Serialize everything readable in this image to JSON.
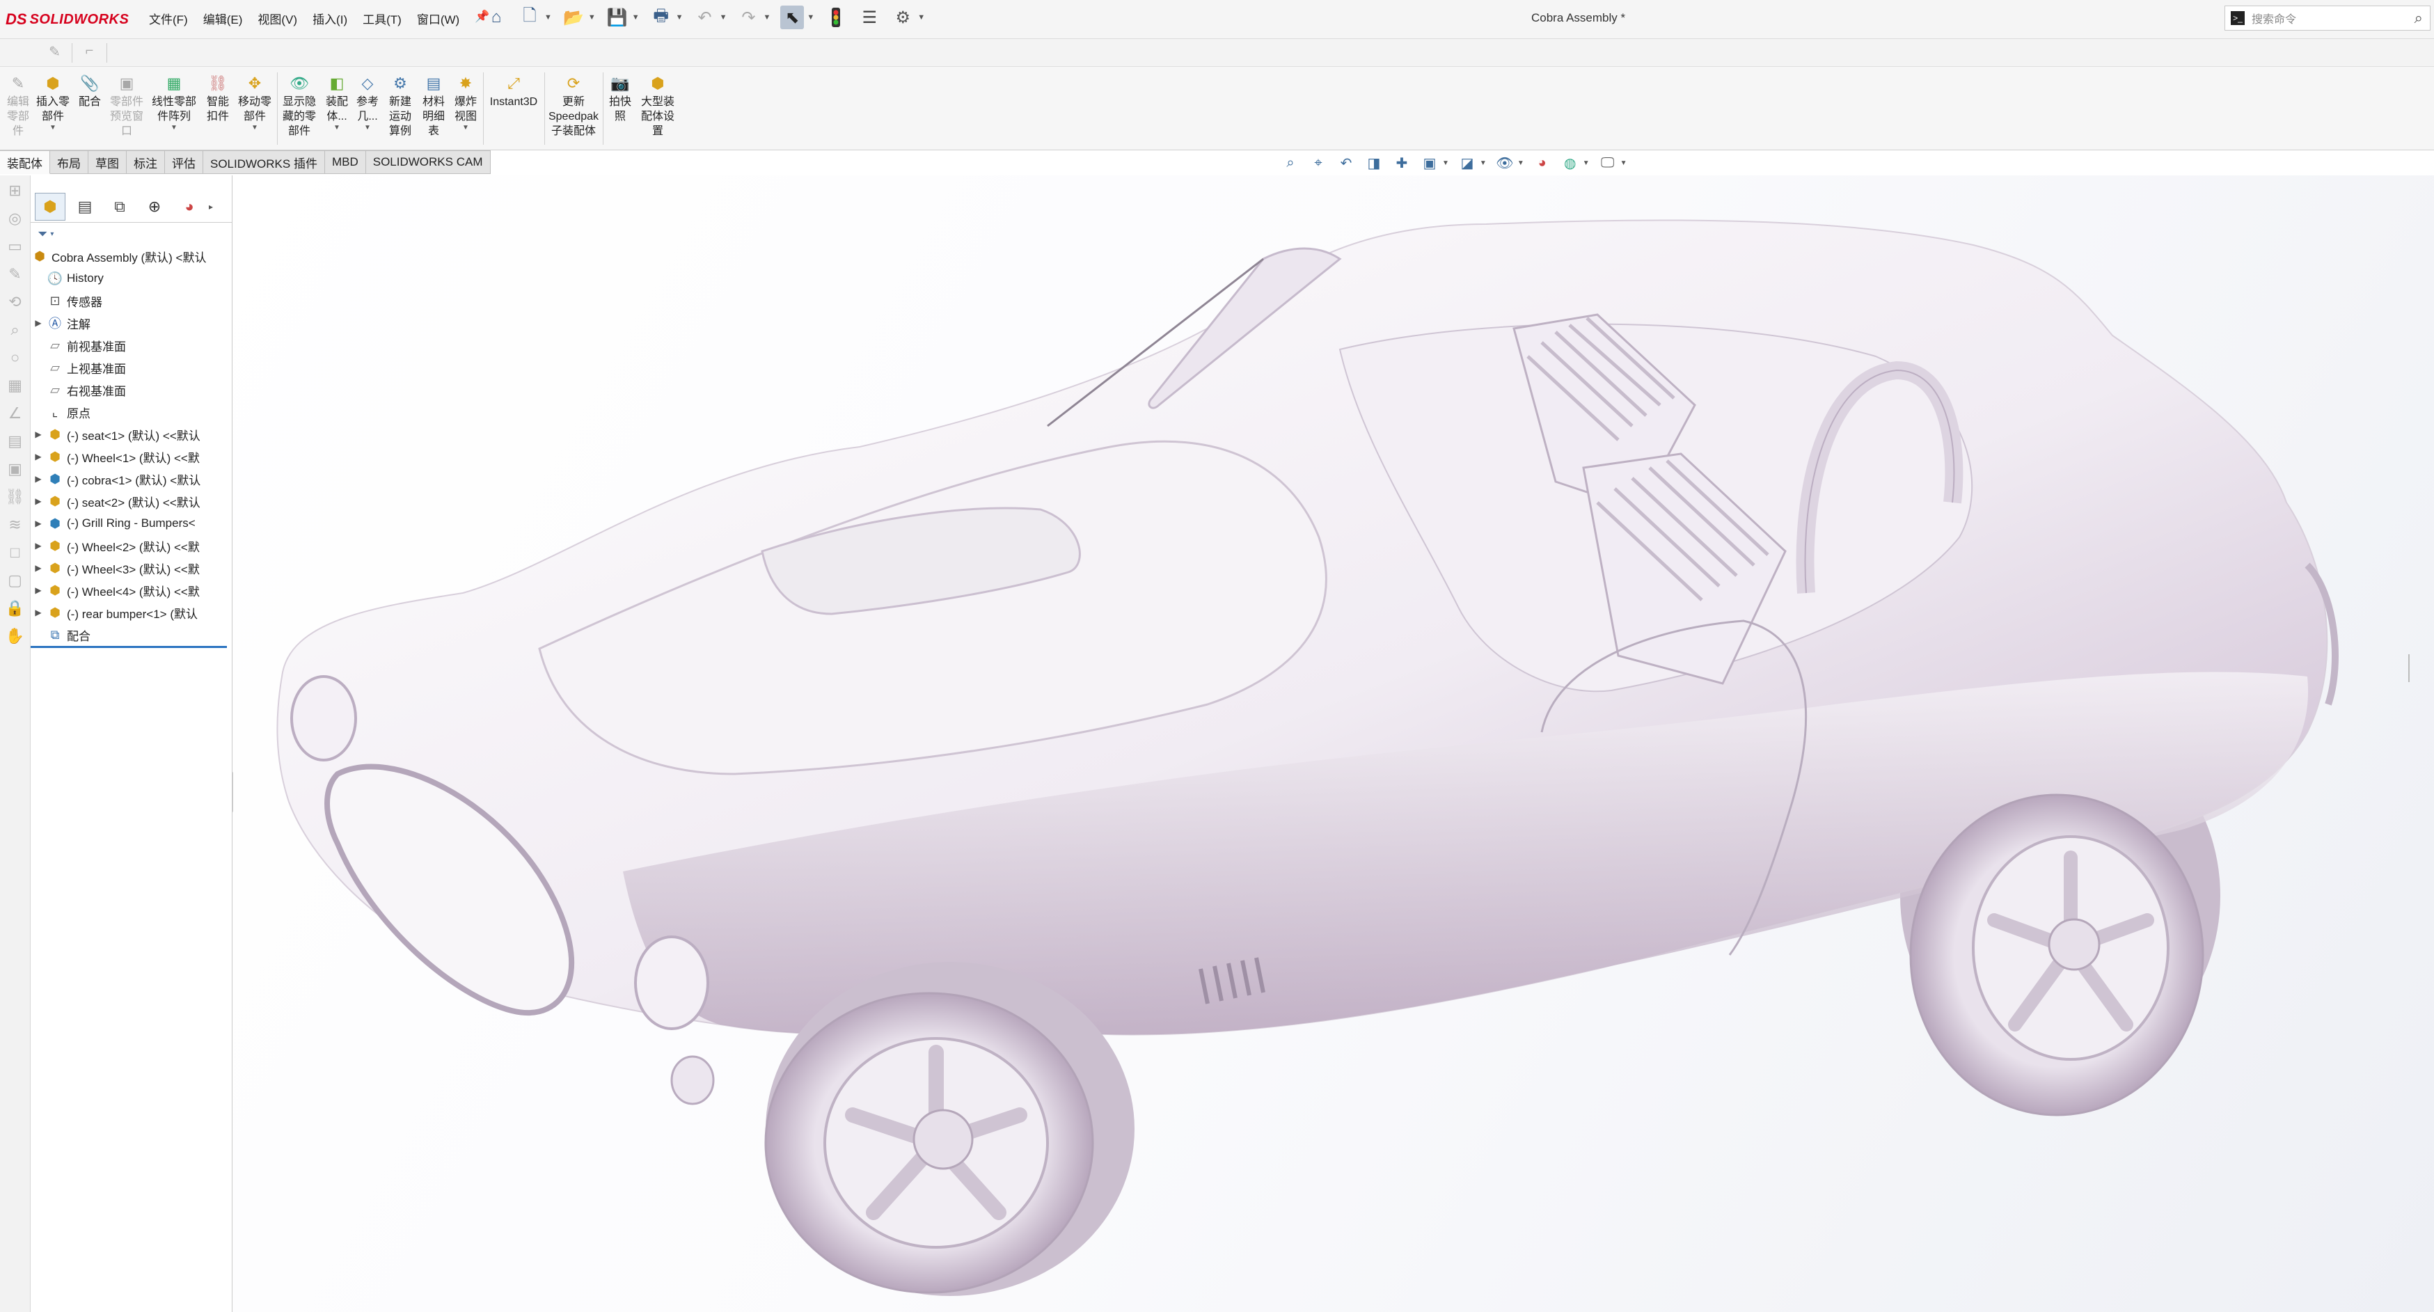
{
  "app": {
    "logo_prefix": "DS",
    "logo_text": "SOLIDWORKS"
  },
  "menu": [
    "文件(F)",
    "编辑(E)",
    "视图(V)",
    "插入(I)",
    "工具(T)",
    "窗口(W)"
  ],
  "document_title": "Cobra Assembly *",
  "search": {
    "placeholder": "搜索命令"
  },
  "ribbon": [
    {
      "label": "编辑\n零部\n件",
      "icon": "edit-component-icon",
      "disabled": true
    },
    {
      "label": "插入零\n部件",
      "icon": "insert-component-icon",
      "disabled": false,
      "dropdown": true
    },
    {
      "label": "配合",
      "icon": "mate-icon",
      "disabled": false
    },
    {
      "label": "零部件\n预览窗\n口",
      "icon": "component-preview-icon",
      "disabled": true
    },
    {
      "label": "线性零部\n件阵列",
      "icon": "linear-pattern-icon",
      "disabled": false,
      "dropdown": true
    },
    {
      "label": "智能\n扣件",
      "icon": "smart-fasteners-icon",
      "disabled": false
    },
    {
      "label": "移动零\n部件",
      "icon": "move-component-icon",
      "disabled": false,
      "dropdown": true
    },
    {
      "label": "显示隐\n藏的零\n部件",
      "icon": "show-hidden-icon",
      "disabled": false
    },
    {
      "label": "装配\n体...",
      "icon": "assembly-features-icon",
      "disabled": false,
      "dropdown": true
    },
    {
      "label": "参考\n几...",
      "icon": "reference-geometry-icon",
      "disabled": false,
      "dropdown": true
    },
    {
      "label": "新建\n运动\n算例",
      "icon": "new-motion-study-icon",
      "disabled": false
    },
    {
      "label": "材料\n明细\n表",
      "icon": "bom-icon",
      "disabled": false
    },
    {
      "label": "爆炸\n视图",
      "icon": "exploded-view-icon",
      "disabled": false,
      "dropdown": true
    },
    {
      "label": "Instant3D",
      "icon": "instant3d-icon",
      "disabled": false
    },
    {
      "label": "更新\nSpeedpak\n子装配体",
      "icon": "speedpak-icon",
      "disabled": false
    },
    {
      "label": "拍快\n照",
      "icon": "snapshot-icon",
      "disabled": false
    },
    {
      "label": "大型装\n配体设\n置",
      "icon": "large-assembly-icon",
      "disabled": false
    }
  ],
  "tabs": [
    "装配体",
    "布局",
    "草图",
    "标注",
    "评估",
    "SOLIDWORKS 插件",
    "MBD",
    "SOLIDWORKS CAM"
  ],
  "active_tab": "装配体",
  "tree": {
    "root": "Cobra Assembly (默认) <默认",
    "items": [
      {
        "label": "History",
        "icon": "history-icon",
        "expandable": false
      },
      {
        "label": "传感器",
        "icon": "sensor-icon",
        "expandable": false
      },
      {
        "label": "注解",
        "icon": "annotations-icon",
        "expandable": true
      },
      {
        "label": "前视基准面",
        "icon": "plane-icon",
        "expandable": false
      },
      {
        "label": "上视基准面",
        "icon": "plane-icon",
        "expandable": false
      },
      {
        "label": "右视基准面",
        "icon": "plane-icon",
        "expandable": false
      },
      {
        "label": "原点",
        "icon": "origin-icon",
        "expandable": false
      },
      {
        "label": "(-) seat<1> (默认) <<默认",
        "icon": "part-icon",
        "expandable": true
      },
      {
        "label": "(-) Wheel<1> (默认) <<默",
        "icon": "part-icon",
        "expandable": true
      },
      {
        "label": "(-) cobra<1> (默认) <默认",
        "icon": "subassembly-icon",
        "expandable": true
      },
      {
        "label": "(-) seat<2> (默认) <<默认",
        "icon": "part-icon",
        "expandable": true
      },
      {
        "label": "(-) Grill Ring - Bumpers<",
        "icon": "subassembly-icon",
        "expandable": true
      },
      {
        "label": "(-) Wheel<2> (默认) <<默",
        "icon": "part-icon",
        "expandable": true
      },
      {
        "label": "(-) Wheel<3> (默认) <<默",
        "icon": "part-icon",
        "expandable": true
      },
      {
        "label": "(-) Wheel<4> (默认) <<默",
        "icon": "part-icon",
        "expandable": true
      },
      {
        "label": "(-) rear bumper<1> (默认",
        "icon": "part-icon",
        "expandable": true
      },
      {
        "label": "配合",
        "icon": "mates-icon",
        "expandable": false
      }
    ]
  },
  "model": {
    "name": "Cobra Assembly",
    "color": "#f3eef5",
    "shade_color": "#b9a6bd"
  }
}
